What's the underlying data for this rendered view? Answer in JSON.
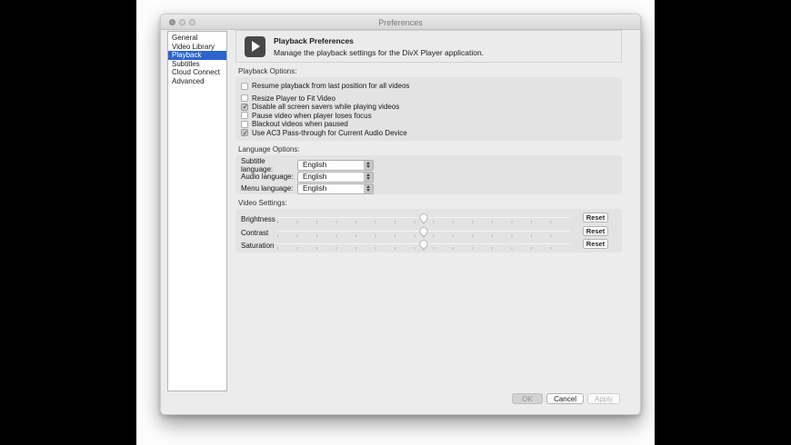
{
  "colors": {
    "accent": "#2b65cc",
    "window_bg": "#ececec",
    "panel_bg": "#e3e3e3"
  },
  "window": {
    "title": "Preferences"
  },
  "sidebar": {
    "items": [
      {
        "label": "General",
        "selected": false
      },
      {
        "label": "Video Library",
        "selected": false
      },
      {
        "label": "Playback",
        "selected": true
      },
      {
        "label": "Subtitles",
        "selected": false
      },
      {
        "label": "Cloud Connect",
        "selected": false
      },
      {
        "label": "Advanced",
        "selected": false
      }
    ]
  },
  "header": {
    "title": "Playback Preferences",
    "subtitle": "Manage the playback settings for the DivX Player application.",
    "icon": "play-icon"
  },
  "sections": {
    "playback": {
      "label": "Playback Options:",
      "checkboxes": [
        {
          "label": "Resume playback from last position for all videos",
          "checked": false
        },
        {
          "label": "Resize Player to Fit Video",
          "checked": false
        },
        {
          "label": "Disable all screen savers while playing videos",
          "checked": true
        },
        {
          "label": "Pause video when player loses focus",
          "checked": false
        },
        {
          "label": "Blackout videos when paused",
          "checked": false
        },
        {
          "label": "Use AC3 Pass-through for Current Audio Device",
          "checked": true
        }
      ]
    },
    "language": {
      "label": "Language Options:",
      "dropdowns": [
        {
          "label": "Subtitle language:",
          "value": "English"
        },
        {
          "label": "Audio language:",
          "value": "English"
        },
        {
          "label": "Menu language:",
          "value": "English"
        }
      ]
    },
    "video": {
      "label": "Video Settings:",
      "sliders": [
        {
          "label": "Brightness",
          "value_percent": 50,
          "reset_label": "Reset"
        },
        {
          "label": "Contrast",
          "value_percent": 50,
          "reset_label": "Reset"
        },
        {
          "label": "Saturation",
          "value_percent": 50,
          "reset_label": "Reset"
        }
      ]
    }
  },
  "footer": {
    "buttons": [
      {
        "label": "OK",
        "enabled": false
      },
      {
        "label": "Cancel",
        "enabled": true
      },
      {
        "label": "Apply",
        "enabled": false
      }
    ]
  }
}
